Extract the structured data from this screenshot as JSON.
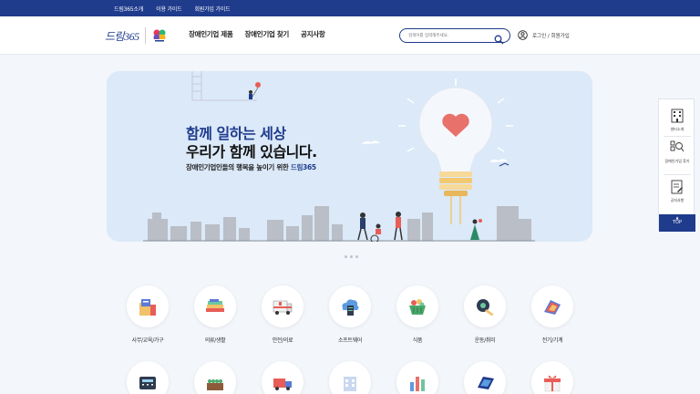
{
  "topbar": {
    "links": [
      "드림365소개",
      "이용 가이드",
      "회원가입 가이드"
    ]
  },
  "header": {
    "logo_text": "드림365",
    "nav": [
      "장애인기업 제품",
      "장애인기업 찾기",
      "공지사항"
    ],
    "search_placeholder": "검색어를 입력해주세요.",
    "login_label": "로그인 / 회원가입"
  },
  "hero": {
    "headline_1": "함께 일하는 세상",
    "headline_2": "우리가 함께 있습니다.",
    "subtitle_prefix": "장애인기업인들의 행복을 높이기 위한 ",
    "subtitle_brand": "드림365"
  },
  "carousel": {
    "dot_count": 3
  },
  "categories": [
    {
      "label": "사무/교육/가구",
      "icon": "office-supplies-icon"
    },
    {
      "label": "의류/생활",
      "icon": "clothing-icon"
    },
    {
      "label": "안전/의료",
      "icon": "ambulance-icon"
    },
    {
      "label": "소프트웨어",
      "icon": "cloud-server-icon"
    },
    {
      "label": "식품",
      "icon": "food-basket-icon"
    },
    {
      "label": "운동/취미",
      "icon": "sports-icon"
    },
    {
      "label": "전기/기계",
      "icon": "cable-reel-icon"
    }
  ],
  "categories_row2": [
    {
      "icon": "telephone-icon"
    },
    {
      "icon": "seedling-tray-icon"
    },
    {
      "icon": "delivery-truck-icon"
    },
    {
      "icon": "building-icon"
    },
    {
      "icon": "bar-chart-icon"
    },
    {
      "icon": "solar-panel-icon"
    },
    {
      "icon": "gift-box-icon"
    }
  ],
  "side_panel": {
    "items": [
      "센터소개",
      "장애인기업 찾기",
      "공지사항"
    ],
    "top_label": "TOP"
  },
  "colors": {
    "brand": "#1f3b8c",
    "hero_bg": "#dbe9f8",
    "page_bg": "#f3f6fa"
  }
}
